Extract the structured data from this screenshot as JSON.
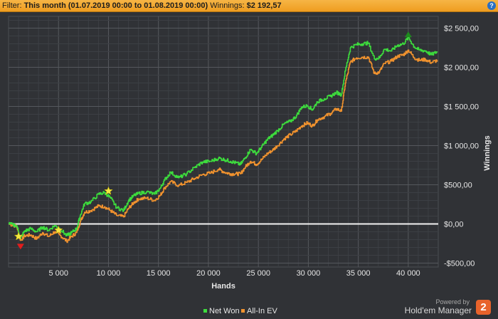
{
  "filter_bar": {
    "prefix": "Filter:",
    "period": "This month (01.07.2019 00:00 to 01.08.2019 00:00)",
    "winnings_label": "Winnings:",
    "winnings_value": "$2 192,57",
    "help_icon": "help-icon"
  },
  "branding": {
    "powered_by": "Powered by",
    "product": "Hold'em Manager",
    "logo_number": "2"
  },
  "chart_data": {
    "type": "line",
    "xlabel": "Hands",
    "ylabel": "Winnings",
    "xlim": [
      0,
      43000
    ],
    "ylim": [
      -550,
      2650
    ],
    "x_ticks": [
      5000,
      10000,
      15000,
      20000,
      25000,
      30000,
      35000,
      40000
    ],
    "x_tick_labels": [
      "5 000",
      "10 000",
      "15 000",
      "20 000",
      "25 000",
      "30 000",
      "35 000",
      "40 000"
    ],
    "y_ticks": [
      2500,
      2000,
      1500,
      1000,
      500,
      0,
      -500
    ],
    "y_tick_labels": [
      "$2 500,00",
      "$2 000,00",
      "$1 500,00",
      "$1 000,00",
      "$500,00",
      "$0,00",
      "-$500,00"
    ],
    "grid": true,
    "legend_position": "bottom-center",
    "series": [
      {
        "name": "Net Won",
        "color": "#3ddc3d",
        "x": [
          0,
          800,
          1200,
          1600,
          2200,
          2800,
          3400,
          4000,
          4600,
          5200,
          5800,
          6300,
          6800,
          7200,
          7600,
          8200,
          9000,
          9600,
          10200,
          10800,
          11500,
          12000,
          12500,
          13000,
          13800,
          14600,
          15200,
          15600,
          16200,
          17000,
          17800,
          18600,
          19400,
          20200,
          21000,
          21600,
          22200,
          22700,
          23200,
          23700,
          24200,
          24800,
          25300,
          25900,
          26400,
          26900,
          27600,
          28200,
          28800,
          29300,
          29900,
          30400,
          30900,
          31600,
          32200,
          32800,
          33300,
          33700,
          34200,
          34800,
          35400,
          36000,
          36600,
          37100,
          37600,
          38300,
          38900,
          39500,
          40000,
          40600,
          41100,
          41700,
          42300,
          42900
        ],
        "values": [
          0,
          -20,
          -180,
          -90,
          -60,
          -100,
          -40,
          -80,
          -20,
          -70,
          -150,
          -110,
          -60,
          120,
          260,
          280,
          380,
          400,
          330,
          210,
          170,
          300,
          360,
          390,
          410,
          380,
          460,
          560,
          660,
          590,
          640,
          720,
          790,
          800,
          840,
          820,
          800,
          780,
          760,
          850,
          950,
          900,
          980,
          1080,
          1130,
          1190,
          1280,
          1310,
          1380,
          1490,
          1510,
          1460,
          1560,
          1600,
          1630,
          1680,
          1650,
          1960,
          2250,
          2290,
          2300,
          2310,
          2110,
          2120,
          2230,
          2210,
          2280,
          2300,
          2380,
          2260,
          2220,
          2210,
          2160,
          2200
        ]
      },
      {
        "name": "All-In EV",
        "color": "#f0922e",
        "x": [
          0,
          800,
          1200,
          1600,
          2200,
          2800,
          3400,
          4000,
          4600,
          5200,
          5800,
          6300,
          6800,
          7200,
          7600,
          8200,
          9000,
          9600,
          10200,
          10800,
          11500,
          12000,
          12500,
          13000,
          13800,
          14600,
          15200,
          15600,
          16200,
          17000,
          17800,
          18600,
          19400,
          20200,
          21000,
          21600,
          22200,
          22700,
          23200,
          23700,
          24200,
          24800,
          25300,
          25900,
          26400,
          26900,
          27600,
          28200,
          28800,
          29300,
          29900,
          30400,
          30900,
          31600,
          32200,
          32800,
          33300,
          33700,
          34200,
          34800,
          35400,
          36000,
          36600,
          37100,
          37600,
          38300,
          38900,
          39500,
          40000,
          40600,
          41100,
          41700,
          42300,
          42900
        ],
        "values": [
          0,
          -30,
          -210,
          -150,
          -140,
          -190,
          -110,
          -160,
          -100,
          -150,
          -220,
          -160,
          -110,
          40,
          150,
          170,
          230,
          220,
          170,
          110,
          90,
          200,
          270,
          320,
          330,
          300,
          370,
          460,
          540,
          490,
          530,
          580,
          630,
          650,
          700,
          660,
          640,
          640,
          640,
          730,
          800,
          760,
          820,
          900,
          940,
          1000,
          1090,
          1140,
          1190,
          1250,
          1290,
          1250,
          1330,
          1370,
          1410,
          1470,
          1440,
          1800,
          2070,
          2120,
          2130,
          2130,
          1920,
          1940,
          2050,
          2080,
          2140,
          2160,
          2220,
          2120,
          2090,
          2100,
          2060,
          2090
        ]
      }
    ],
    "markers": [
      {
        "type": "star",
        "color": "#f5e642",
        "x": 1000,
        "y": -160
      },
      {
        "type": "star",
        "color": "#f5e642",
        "x": 5000,
        "y": -80
      },
      {
        "type": "star",
        "color": "#f5e642",
        "x": 10000,
        "y": 420
      },
      {
        "type": "triangle-down",
        "color": "#e41c1c",
        "x": 1200,
        "y": -290
      },
      {
        "type": "triangle-up",
        "color": "#1e8a1e",
        "x": 40000,
        "y": 2420
      }
    ]
  }
}
